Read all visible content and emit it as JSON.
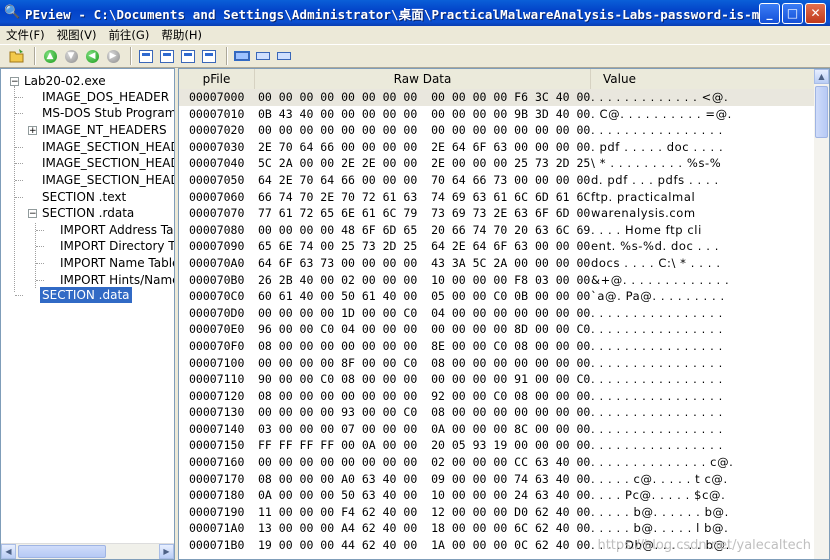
{
  "window": {
    "title": "PEview - C:\\Documents and Settings\\Administrator\\桌面\\PracticalMalwareAnalysis-Labs-password-is-ma..."
  },
  "menu": [
    "文件(F)",
    "视图(V)",
    "前往(G)",
    "帮助(H)"
  ],
  "tree": [
    {
      "label": "Lab20-02.exe",
      "level": 0,
      "expander": "minus"
    },
    {
      "label": "IMAGE_DOS_HEADER",
      "level": 1
    },
    {
      "label": "MS-DOS Stub Program",
      "level": 1
    },
    {
      "label": "IMAGE_NT_HEADERS",
      "level": 1,
      "expander": "plus"
    },
    {
      "label": "IMAGE_SECTION_HEADER .text",
      "level": 1
    },
    {
      "label": "IMAGE_SECTION_HEADER .rdata",
      "level": 1
    },
    {
      "label": "IMAGE_SECTION_HEADER .data",
      "level": 1
    },
    {
      "label": "SECTION .text",
      "level": 1
    },
    {
      "label": "SECTION .rdata",
      "level": 1,
      "expander": "minus"
    },
    {
      "label": "IMPORT Address Table",
      "level": 2
    },
    {
      "label": "IMPORT Directory Table",
      "level": 2
    },
    {
      "label": "IMPORT Name Table",
      "level": 2
    },
    {
      "label": "IMPORT Hints/Names & DLL Names",
      "level": 2
    },
    {
      "label": "SECTION .data",
      "level": 1,
      "selected": true
    }
  ],
  "columns": {
    "addr": "pFile",
    "hex": "Raw Data",
    "val": "Value"
  },
  "rows": [
    {
      "addr": "00007000",
      "hex": "00 00 00 00 00 00 00 00  00 00 00 00 F6 3C 40 00",
      "val": ". . . . . . . . . . . . . <@."
    },
    {
      "addr": "00007010",
      "hex": "0B 43 40 00 00 00 00 00  00 00 00 00 9B 3D 40 00",
      "val": ". C@. . . . . . . . . . =@."
    },
    {
      "addr": "00007020",
      "hex": "00 00 00 00 00 00 00 00  00 00 00 00 00 00 00 00",
      "val": ". . . . . . . . . . . . . . . ."
    },
    {
      "addr": "00007030",
      "hex": "2E 70 64 66 00 00 00 00  2E 64 6F 63 00 00 00 00",
      "val": ". pdf . . . . . doc . . . ."
    },
    {
      "addr": "00007040",
      "hex": "5C 2A 00 00 2E 2E 00 00  2E 00 00 00 25 73 2D 25",
      "val": "\\ * . . . . . . . . . %s-%"
    },
    {
      "addr": "00007050",
      "hex": "64 2E 70 64 66 00 00 00  70 64 66 73 00 00 00 00",
      "val": "d. pdf . . . pdfs . . . ."
    },
    {
      "addr": "00007060",
      "hex": "66 74 70 2E 70 72 61 63  74 69 63 61 6C 6D 61 6C",
      "val": "ftp. practicalmal"
    },
    {
      "addr": "00007070",
      "hex": "77 61 72 65 6E 61 6C 79  73 69 73 2E 63 6F 6D 00",
      "val": "warenalysis.com"
    },
    {
      "addr": "00007080",
      "hex": "00 00 00 00 48 6F 6D 65  20 66 74 70 20 63 6C 69",
      "val": ". . . . Home ftp cli"
    },
    {
      "addr": "00007090",
      "hex": "65 6E 74 00 25 73 2D 25  64 2E 64 6F 63 00 00 00",
      "val": "ent. %s-%d. doc . . ."
    },
    {
      "addr": "000070A0",
      "hex": "64 6F 63 73 00 00 00 00  43 3A 5C 2A 00 00 00 00",
      "val": "docs . . . . C:\\ * . . . ."
    },
    {
      "addr": "000070B0",
      "hex": "26 2B 40 00 02 00 00 00  10 00 00 00 F8 03 00 00",
      "val": "&+@. . . . . . . . . . . . ."
    },
    {
      "addr": "000070C0",
      "hex": "60 61 40 00 50 61 40 00  05 00 00 C0 0B 00 00 00",
      "val": "`a@. Pa@. . . . . . . . ."
    },
    {
      "addr": "000070D0",
      "hex": "00 00 00 00 1D 00 00 C0  04 00 00 00 00 00 00 00",
      "val": ". . . . . . . . . . . . . . . ."
    },
    {
      "addr": "000070E0",
      "hex": "96 00 00 C0 04 00 00 00  00 00 00 00 8D 00 00 C0",
      "val": ". . . . . . . . . . . . . . . ."
    },
    {
      "addr": "000070F0",
      "hex": "08 00 00 00 00 00 00 00  8E 00 00 C0 08 00 00 00",
      "val": ". . . . . . . . . . . . . . . ."
    },
    {
      "addr": "00007100",
      "hex": "00 00 00 00 8F 00 00 C0  08 00 00 00 00 00 00 00",
      "val": ". . . . . . . . . . . . . . . ."
    },
    {
      "addr": "00007110",
      "hex": "90 00 00 C0 08 00 00 00  00 00 00 00 91 00 00 C0",
      "val": ". . . . . . . . . . . . . . . ."
    },
    {
      "addr": "00007120",
      "hex": "08 00 00 00 00 00 00 00  92 00 00 C0 08 00 00 00",
      "val": ". . . . . . . . . . . . . . . ."
    },
    {
      "addr": "00007130",
      "hex": "00 00 00 00 93 00 00 C0  08 00 00 00 00 00 00 00",
      "val": ". . . . . . . . . . . . . . . ."
    },
    {
      "addr": "00007140",
      "hex": "03 00 00 00 07 00 00 00  0A 00 00 00 8C 00 00 00",
      "val": ". . . . . . . . . . . . . . . ."
    },
    {
      "addr": "00007150",
      "hex": "FF FF FF FF 00 0A 00 00  20 05 93 19 00 00 00 00",
      "val": ". . . . . . . . . . . . . . . ."
    },
    {
      "addr": "00007160",
      "hex": "00 00 00 00 00 00 00 00  02 00 00 00 CC 63 40 00",
      "val": ". . . . . . . . . . . . . . c@."
    },
    {
      "addr": "00007170",
      "hex": "08 00 00 00 A0 63 40 00  09 00 00 00 74 63 40 00",
      "val": ". . . . . c@. . . . . t c@."
    },
    {
      "addr": "00007180",
      "hex": "0A 00 00 00 50 63 40 00  10 00 00 00 24 63 40 00",
      "val": ". . . . Pc@. . . . . $c@."
    },
    {
      "addr": "00007190",
      "hex": "11 00 00 00 F4 62 40 00  12 00 00 00 D0 62 40 00",
      "val": ". . . . . b@. . . . . . b@."
    },
    {
      "addr": "000071A0",
      "hex": "13 00 00 00 A4 62 40 00  18 00 00 00 6C 62 40 00",
      "val": ". . . . . b@. . . . . l b@."
    },
    {
      "addr": "000071B0",
      "hex": "19 00 00 00 44 62 40 00  1A 00 00 00 0C 62 40 00",
      "val": ". . . . Db@. . . . . . b@."
    }
  ],
  "watermark": "https://blog.csdn.net/yalecaltech",
  "icons": {
    "app": "magnifier-icon",
    "open": "open-folder-icon",
    "back": "green-arrow-back-icon",
    "forward": "green-arrow-forward-icon",
    "up": "green-arrow-up-icon",
    "down": "gray-arrow-down-icon",
    "save": "save-icon",
    "goto-section": "goto-section-icon",
    "import": "import-icon",
    "export": "export-icon",
    "view-bytes": "view-bytes-icon",
    "view-words": "view-words-icon",
    "view-dwords": "view-dwords-icon"
  }
}
